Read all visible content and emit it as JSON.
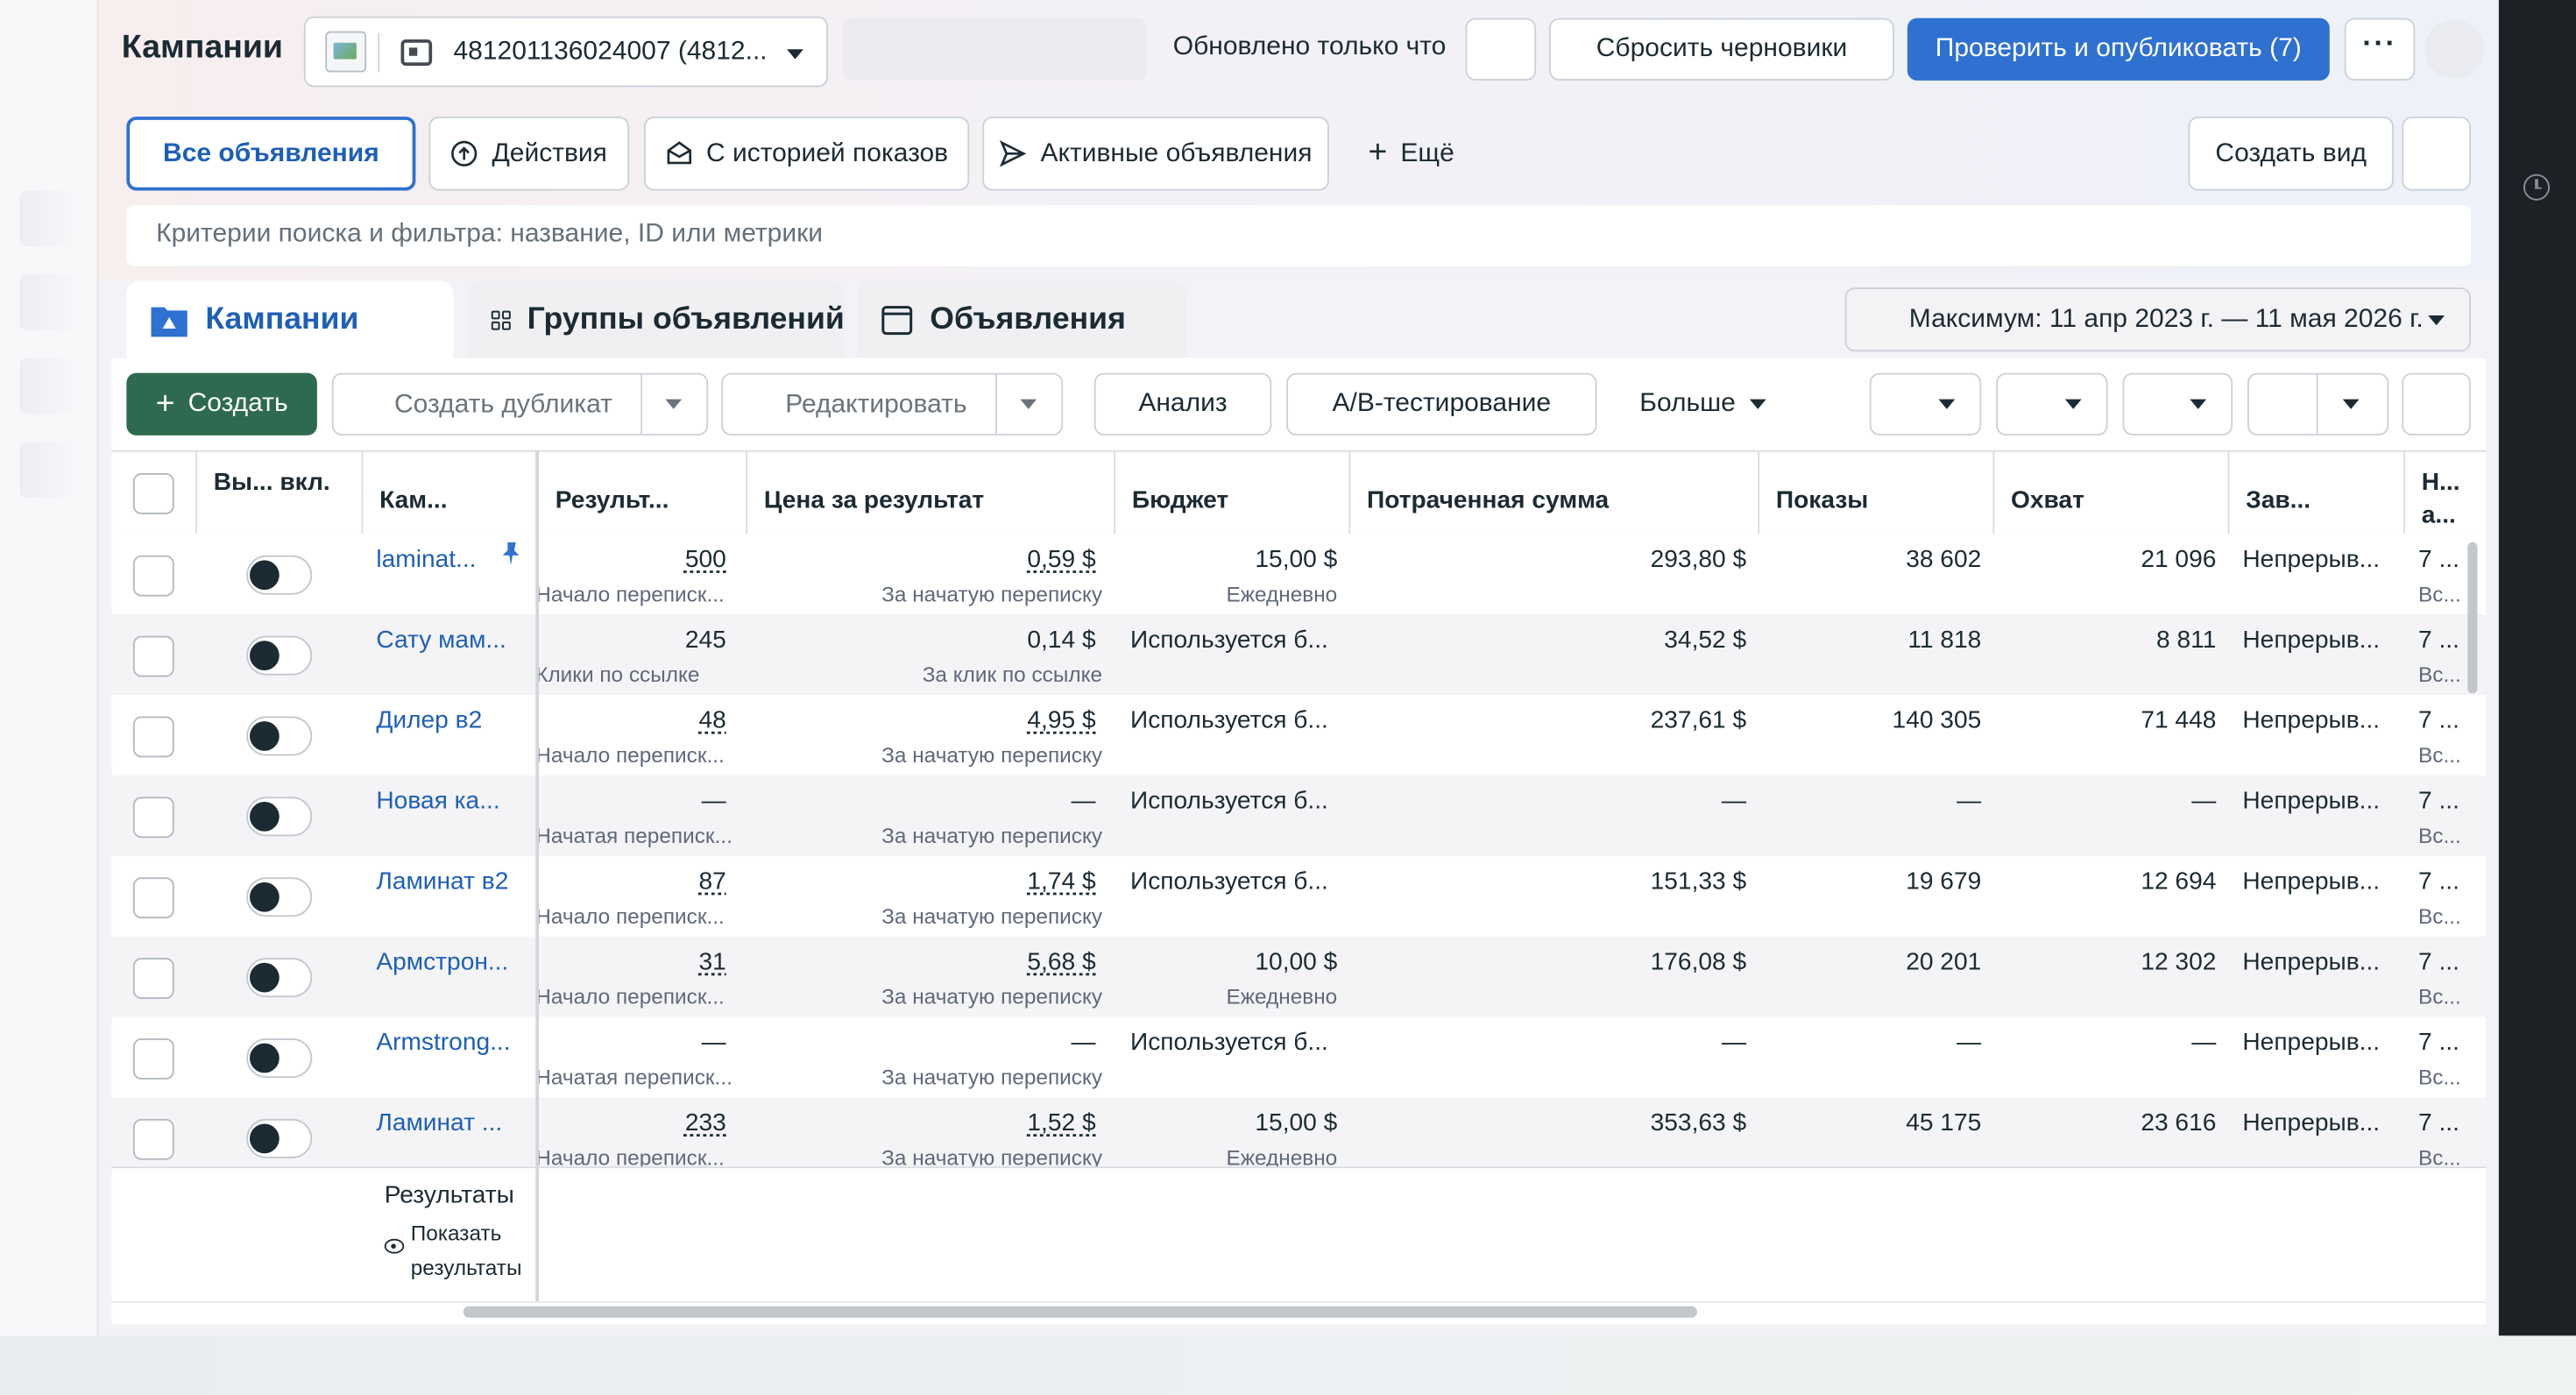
{
  "header": {
    "title": "Кампании",
    "account": "481201136024007 (4812...",
    "updated": "Обновлено только что",
    "reset_drafts": "Сбросить черновики",
    "publish": "Проверить и опубликовать (7)",
    "more_glyph": "···"
  },
  "views": {
    "all_ads": "Все объявления",
    "actions": "Действия",
    "with_history": "С историей показов",
    "active_ads": "Активные объявления",
    "more": "Ещё",
    "create_view": "Создать вид"
  },
  "search": {
    "placeholder": "Критерии поиска и фильтра: название, ID или метрики"
  },
  "levels": {
    "campaigns": "Кампании",
    "adsets": "Группы объявлений",
    "ads": "Объявления",
    "date_range": "Максимум: 11 апр 2023 г. — 11 мая 2026 г."
  },
  "toolbar": {
    "create": "Создать",
    "duplicate": "Создать дубликат",
    "edit": "Редактировать",
    "analysis": "Анализ",
    "ab_test": "A/B-тестирование",
    "more": "Больше"
  },
  "table": {
    "headers": {
      "onoff": "Вы... вкл.",
      "campaign": "Кам...",
      "results": "Результ...",
      "cost_per_result": "Цена за результат",
      "budget": "Бюджет",
      "spent": "Потраченная сумма",
      "impressions": "Показы",
      "reach": "Охват",
      "ends": "Зав...",
      "last": "Н... а..."
    },
    "rows": [
      {
        "name": "laminat...",
        "result": "500",
        "result_sub": "Начало переписк...",
        "cpr": "0,59 $",
        "cpr_sub": "За начатую переписку",
        "budget": "15,00 $",
        "budget_sub": "Ежедневно",
        "spent": "293,80 $",
        "impr": "38 602",
        "reach": "21 096",
        "ends": "Непрерыв...",
        "last": "7 ...",
        "last_sub": "Вс..."
      },
      {
        "name": "Сату мам...",
        "result": "245",
        "result_sub": "Клики по ссылке",
        "cpr": "0,14 $",
        "cpr_sub": "За клик по ссылке",
        "budget": "Используется б...",
        "budget_sub": "",
        "spent": "34,52 $",
        "impr": "11 818",
        "reach": "8 811",
        "ends": "Непрерыв...",
        "last": "7 ...",
        "last_sub": "Вс..."
      },
      {
        "name": "Дилер в2",
        "result": "48",
        "result_sub": "Начало переписк...",
        "cpr": "4,95 $",
        "cpr_sub": "За начатую переписку",
        "budget": "Используется б...",
        "budget_sub": "",
        "spent": "237,61 $",
        "impr": "140 305",
        "reach": "71 448",
        "ends": "Непрерыв...",
        "last": "7 ...",
        "last_sub": "Вс..."
      },
      {
        "name": "Новая ка...",
        "result": "—",
        "result_sub": "Начатая переписк...",
        "cpr": "—",
        "cpr_sub": "За начатую переписку",
        "budget": "Используется б...",
        "budget_sub": "",
        "spent": "—",
        "impr": "—",
        "reach": "—",
        "ends": "Непрерыв...",
        "last": "7 ...",
        "last_sub": "Вс..."
      },
      {
        "name": "Ламинат в2",
        "result": "87",
        "result_sub": "Начало переписк...",
        "cpr": "1,74 $",
        "cpr_sub": "За начатую переписку",
        "budget": "Используется б...",
        "budget_sub": "",
        "spent": "151,33 $",
        "impr": "19 679",
        "reach": "12 694",
        "ends": "Непрерыв...",
        "last": "7 ...",
        "last_sub": "Вс..."
      },
      {
        "name": "Армстрон...",
        "result": "31",
        "result_sub": "Начало переписк...",
        "cpr": "5,68 $",
        "cpr_sub": "За начатую переписку",
        "budget": "10,00 $",
        "budget_sub": "Ежедневно",
        "spent": "176,08 $",
        "impr": "20 201",
        "reach": "12 302",
        "ends": "Непрерыв...",
        "last": "7 ...",
        "last_sub": "Вс..."
      },
      {
        "name": "Armstrong...",
        "result": "—",
        "result_sub": "Начатая переписк...",
        "cpr": "—",
        "cpr_sub": "За начатую переписку",
        "budget": "Используется б...",
        "budget_sub": "",
        "spent": "—",
        "impr": "—",
        "reach": "—",
        "ends": "Непрерыв...",
        "last": "7 ...",
        "last_sub": "Вс..."
      },
      {
        "name": "Ламинат ...",
        "result": "233",
        "result_sub": "Начало переписк...",
        "cpr": "1,52 $",
        "cpr_sub": "За начатую переписку",
        "budget": "15,00 $",
        "budget_sub": "Ежедневно",
        "spent": "353,63 $",
        "impr": "45 175",
        "reach": "23 616",
        "ends": "Непрерыв...",
        "last": "7 ...",
        "last_sub": "Вс..."
      }
    ],
    "underlined_rows": [
      0,
      2,
      4,
      5,
      7
    ]
  },
  "footer": {
    "results": "Результаты",
    "show_results": "Показать результаты"
  }
}
